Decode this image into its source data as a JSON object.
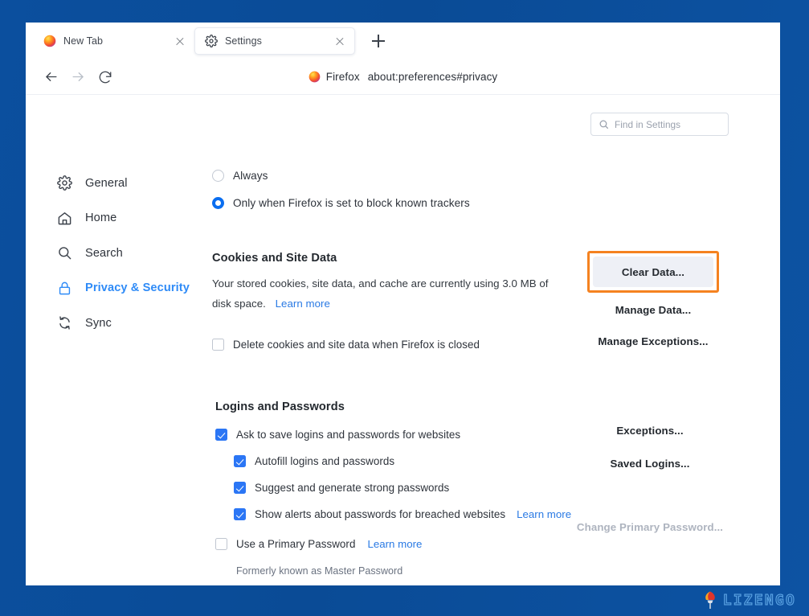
{
  "browser": {
    "tabs": [
      {
        "title": "New Tab",
        "favicon": "firefox-icon",
        "active": false
      },
      {
        "title": "Settings",
        "favicon": "gear-icon",
        "active": true
      }
    ],
    "new_tab_label": "+",
    "urlbar": {
      "brand": "Firefox",
      "url": "about:preferences#privacy"
    },
    "nav": {
      "back": "back-arrow-icon",
      "forward": "forward-arrow-icon",
      "reload": "reload-icon"
    }
  },
  "search": {
    "placeholder": "Find in Settings"
  },
  "sidebar": {
    "items": [
      {
        "label": "General",
        "icon": "gear-icon",
        "active": false
      },
      {
        "label": "Home",
        "icon": "home-icon",
        "active": false
      },
      {
        "label": "Search",
        "icon": "magnifier-icon",
        "active": false
      },
      {
        "label": "Privacy & Security",
        "icon": "lock-icon",
        "active": true
      },
      {
        "label": "Sync",
        "icon": "sync-icon",
        "active": false
      }
    ]
  },
  "main": {
    "tracking_options": [
      {
        "label": "Always",
        "checked": false
      },
      {
        "label": "Only when Firefox is set to block known trackers",
        "checked": true
      }
    ],
    "cookies_section": {
      "title": "Cookies and Site Data",
      "description_part1": "Your stored cookies, site data, and cache are currently using 3.0 MB of disk space.",
      "learn_more": "Learn more",
      "delete_checkbox": {
        "label": "Delete cookies and site data when Firefox is closed",
        "checked": false
      },
      "buttons": {
        "clear_data": "Clear Data...",
        "manage_data": "Manage Data...",
        "manage_exceptions": "Manage Exceptions..."
      }
    },
    "logins_section": {
      "title": "Logins and Passwords",
      "checkboxes": [
        {
          "label": "Ask to save logins and passwords for websites",
          "checked": true,
          "indent": 0
        },
        {
          "label": "Autofill logins and passwords",
          "checked": true,
          "indent": 1
        },
        {
          "label": "Suggest and generate strong passwords",
          "checked": true,
          "indent": 1
        },
        {
          "label": "Show alerts about passwords for breached websites",
          "checked": true,
          "indent": 1
        }
      ],
      "breached_learn_more": "Learn more",
      "primary_password": {
        "label": "Use a Primary Password",
        "checked": false,
        "learn_more": "Learn more",
        "note": "Formerly known as Master Password"
      },
      "buttons": {
        "exceptions": "Exceptions...",
        "saved_logins": "Saved Logins...",
        "change_primary_password": "Change Primary Password...",
        "change_primary_password_disabled": true
      }
    }
  },
  "watermark": {
    "text": "LIZENGO"
  },
  "colors": {
    "page_background": "#0b4f9e",
    "accent_blue": "#2b76f5",
    "link_blue": "#2a7ae4",
    "active_nav": "#2f8bf7",
    "highlight_orange": "#f58220",
    "button_fill": "#eef0f6"
  }
}
